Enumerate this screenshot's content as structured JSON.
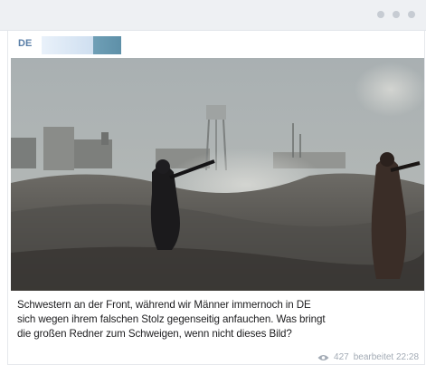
{
  "channel": {
    "label": "DE"
  },
  "post": {
    "image_alt_icon": "photo",
    "caption_lines": [
      "Schwestern an der Front, während wir Männer immernoch in DE",
      "sich wegen ihrem falschen Stolz gegenseitig anfauchen. Was bringt",
      "die großen Redner zum Schweigen, wenn nicht dieses Bild?"
    ],
    "views": "427",
    "edited": "bearbeitet 22:28"
  },
  "colors": {
    "channel_label": "#5a7fa8",
    "meta_text": "#a3abb5",
    "topbar": "#eef0f3"
  }
}
